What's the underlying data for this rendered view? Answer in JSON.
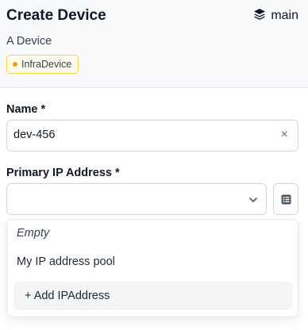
{
  "header": {
    "title": "Create Device",
    "branch": "main",
    "subtitle": "A Device",
    "kind_badge": "InfraDevice"
  },
  "form": {
    "name": {
      "label": "Name *",
      "value": "dev-456",
      "clear_icon": "×"
    },
    "primary_ip": {
      "label": "Primary IP Address *",
      "value": ""
    }
  },
  "dropdown": {
    "empty_label": "Empty",
    "options": [
      "My IP address pool"
    ],
    "add_label": "+ Add IPAddress"
  },
  "colors": {
    "badge_dot": "#f59e0b",
    "badge_border": "#fcd34d",
    "header_bg": "#f8f9fa"
  },
  "icons": {
    "branch": "layers-icon",
    "clear": "close-icon",
    "dropdown": "chevron-down-icon",
    "pool": "list-icon"
  }
}
